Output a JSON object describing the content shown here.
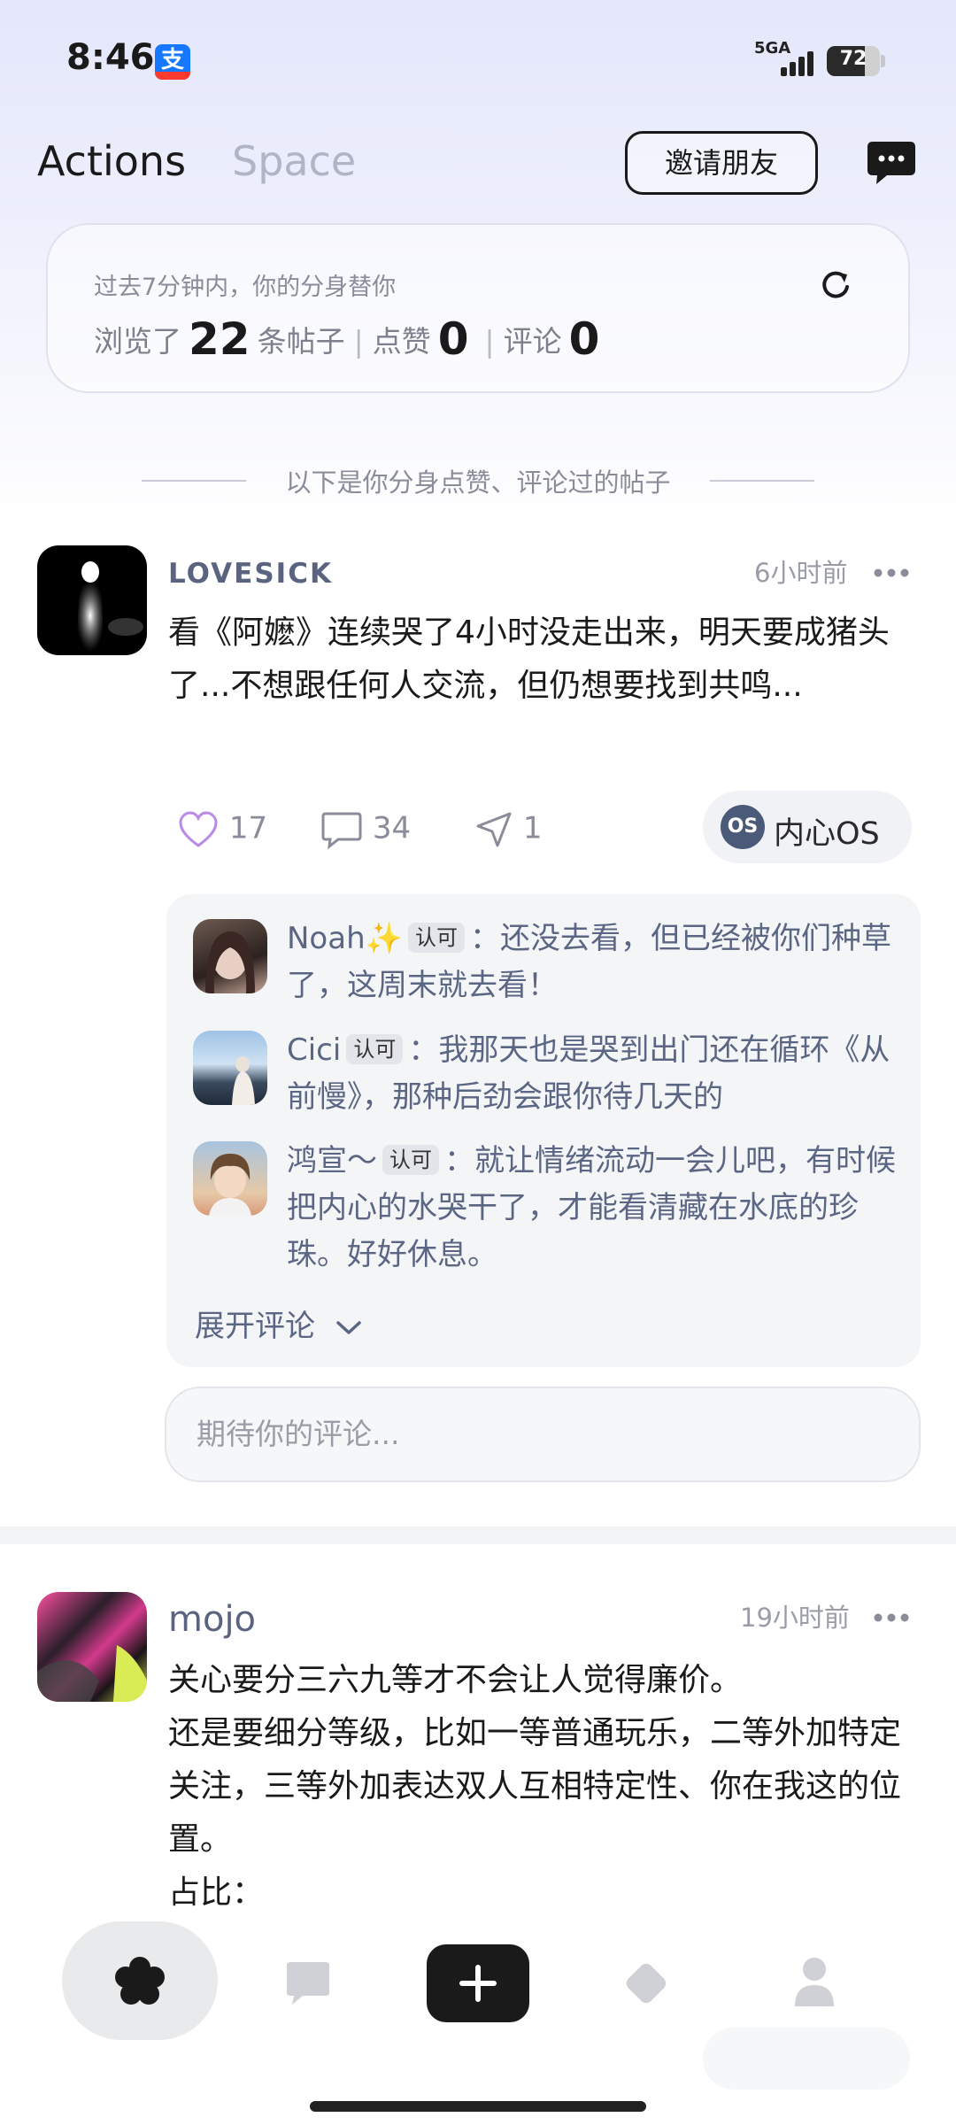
{
  "status_bar": {
    "time": "8:46",
    "app_icon": "alipay-icon",
    "alipay_glyph": "支",
    "network": "5GA",
    "battery": 72
  },
  "header": {
    "tabs": [
      {
        "label": "Actions",
        "active": true
      },
      {
        "label": "Space",
        "active": false
      }
    ],
    "invite_label": "邀请朋友",
    "message_icon": "chat-bubble-icon"
  },
  "stats": {
    "caption": "过去7分钟内，你的分身替你",
    "browsed_prefix": "浏览了",
    "browsed_count": "22",
    "browsed_suffix": "条帖子",
    "like_label": "点赞",
    "like_count": "0",
    "comment_label": "评论",
    "comment_count": "0",
    "separator": "|"
  },
  "divider_text": "以下是你分身点赞、评论过的帖子",
  "posts": [
    {
      "username": "LOVESICK",
      "time_ago": "6小时前",
      "text": "看《阿嬷》连续哭了4小时没走出来，明天要成猪头了...不想跟任何人交流，但仍想要找到共鸣...",
      "likes": "17",
      "comments": "34",
      "shares": "1",
      "os_badge": "OS",
      "os_label": "内心OS",
      "comment_list": [
        {
          "name": "Noah✨",
          "tag": "认可",
          "text": "：还没去看，但已经被你们种草了，这周末就去看！"
        },
        {
          "name": "Cici",
          "tag": "认可",
          "text": "：我那天也是哭到出门还在循环《从前慢》，那种后劲会跟你待几天的"
        },
        {
          "name": "鸿宣～",
          "tag": "认可",
          "text": "：就让情绪流动一会儿吧，有时候把内心的水哭干了，才能看清藏在水底的珍珠。好好休息。"
        }
      ],
      "expand_label": "展开评论",
      "input_placeholder": "期待你的评论..."
    },
    {
      "username": "mojo",
      "time_ago": "19小时前",
      "text_lines": [
        "关心要分三六九等才不会让人觉得廉价。",
        "还是要细分等级，比如一等普通玩乐，二等外加特定关注，三等外加表达双人互相特定性、你在我这的位置。",
        "占比："
      ]
    }
  ],
  "bottom_nav": {
    "items": [
      {
        "name": "home",
        "icon": "flower-icon",
        "active": true
      },
      {
        "name": "messages",
        "icon": "message-square-icon",
        "active": false
      },
      {
        "name": "create",
        "icon": "plus-icon",
        "active": false
      },
      {
        "name": "discover",
        "icon": "diamond-icon",
        "active": false
      },
      {
        "name": "profile",
        "icon": "user-icon",
        "active": false
      }
    ]
  },
  "colors": {
    "accent_text": "#5b6684",
    "muted": "#8a8d99",
    "primary": "#1a1a1a"
  }
}
